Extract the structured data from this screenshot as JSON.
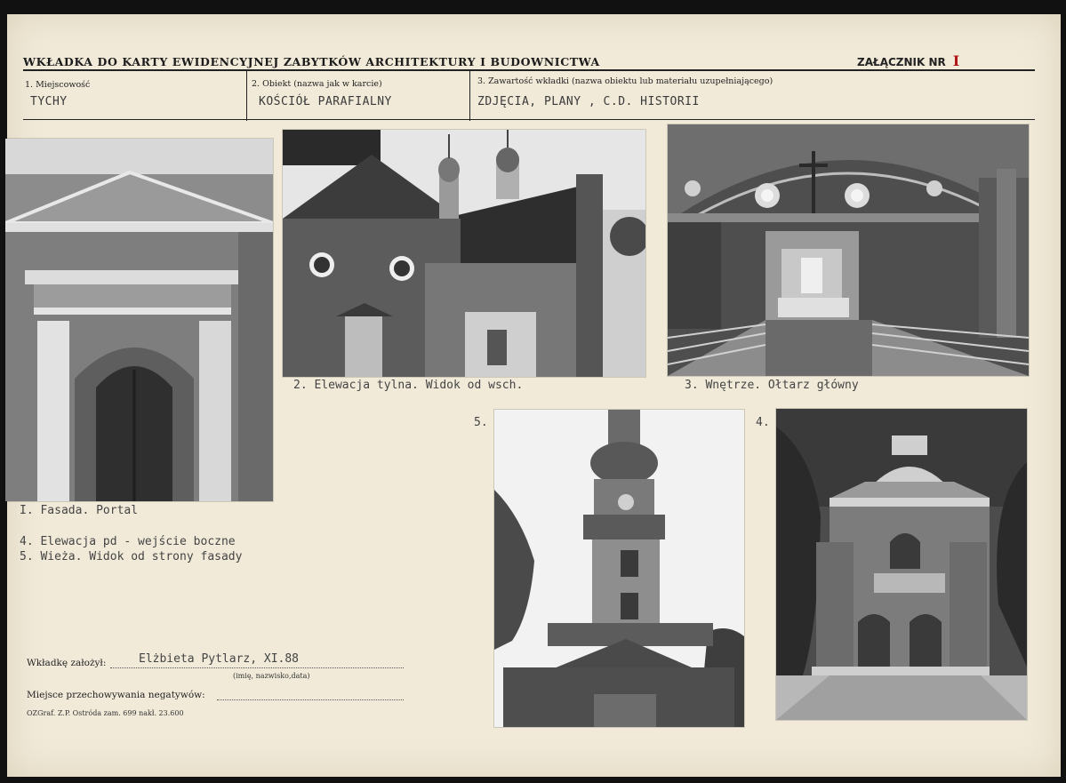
{
  "header": {
    "title": "WKŁADKA DO KARTY EWIDENCYJNEJ ZABYTKÓW ARCHITEKTURY I BUDOWNICTWA",
    "attachment_label": "ZAŁĄCZNIK NR",
    "attachment_number": "I"
  },
  "fields": {
    "locality_label": "1. Miejscowość",
    "locality_value": "TYCHY",
    "object_label": "2. Obiekt (nazwa jak w karcie)",
    "object_value": "KOŚCIÓŁ PARAFIALNY",
    "contents_label": "3. Zawartość wkładki (nazwa obiektu lub materiału uzupełniającego)",
    "contents_value": "ZDJĘCIA, PLANY , C.D. HISTORII"
  },
  "photos": {
    "p1": {
      "number": "",
      "icon": "church-portal-photo"
    },
    "p2": {
      "number": "",
      "icon": "church-rear-elevation-photo"
    },
    "p3": {
      "number": "",
      "icon": "church-interior-altar-photo"
    },
    "p4": {
      "number": "4.",
      "icon": "church-side-entrance-photo"
    },
    "p5": {
      "number": "5.",
      "icon": "church-tower-photo"
    }
  },
  "captions": {
    "c1": "I. Fasada. Portal",
    "c2": "2. Elewacja tylna. Widok od wsch.",
    "c3": "3. Wnętrze. Ołtarz główny",
    "c4": "4. Elewacja pd - wejście boczne",
    "c5": "5. Wieża. Widok od strony fasady"
  },
  "footer": {
    "founder_label": "Wkładkę założył:",
    "founder_value": "Elżbieta Pytlarz, XI.88",
    "founder_hint": "(imię, nazwisko,data)",
    "storage_label": "Miejsce przechowywania negatywów:",
    "storage_value": "",
    "printer": "OZGraf. Z.P. Ostróda zam. 699 nakł. 23.600"
  },
  "colors": {
    "paper": "#f1ead9",
    "ink": "#1c1c1c",
    "stamp_red": "#b01818"
  }
}
